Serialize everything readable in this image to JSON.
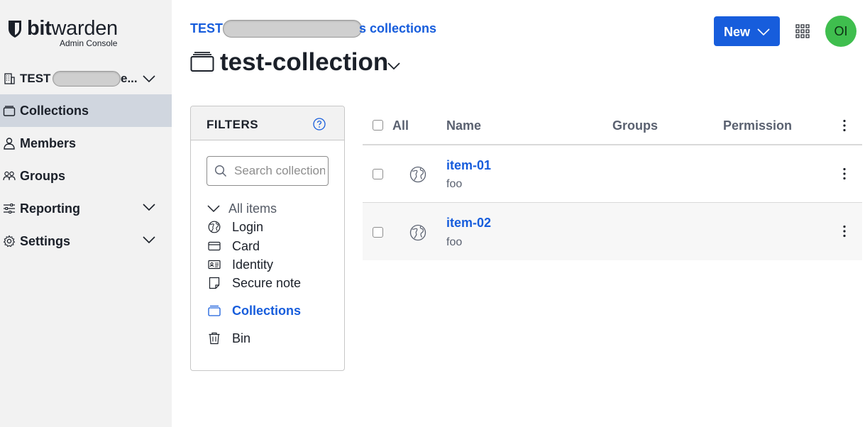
{
  "sidebar": {
    "logo_bold": "bit",
    "logo_light": "warden",
    "logo_sub": "Admin Console",
    "org_name_prefix": "TEST",
    "org_name_suffix": "e...",
    "items": [
      {
        "label": "Collections",
        "icon": "collection-icon",
        "active": true
      },
      {
        "label": "Members",
        "icon": "user-icon"
      },
      {
        "label": "Groups",
        "icon": "users-icon"
      },
      {
        "label": "Reporting",
        "icon": "sliders-icon"
      },
      {
        "label": "Settings",
        "icon": "cog-icon"
      }
    ]
  },
  "header": {
    "breadcrumb_prefix": "TEST",
    "breadcrumb_suffix": "s collections",
    "title": "test-collection",
    "new_button": "New",
    "avatar_initials": "OI"
  },
  "filters": {
    "title": "FILTERS",
    "search_placeholder": "Search collection",
    "all_items": "All items",
    "types": [
      {
        "label": "Login",
        "icon": "globe-icon"
      },
      {
        "label": "Card",
        "icon": "credit-card-icon"
      },
      {
        "label": "Identity",
        "icon": "id-card-icon"
      },
      {
        "label": "Secure note",
        "icon": "sticky-note-icon"
      }
    ],
    "collections": "Collections",
    "bin": "Bin"
  },
  "table": {
    "headers": {
      "all": "All",
      "name": "Name",
      "groups": "Groups",
      "permission": "Permission"
    },
    "rows": [
      {
        "name": "item-01",
        "sub": "foo"
      },
      {
        "name": "item-02",
        "sub": "foo"
      }
    ]
  },
  "colors": {
    "accent": "#175ddc",
    "sidebar_bg": "#f2f2f2",
    "active_nav": "#d0d6df",
    "avatar": "#3fbe4e"
  }
}
